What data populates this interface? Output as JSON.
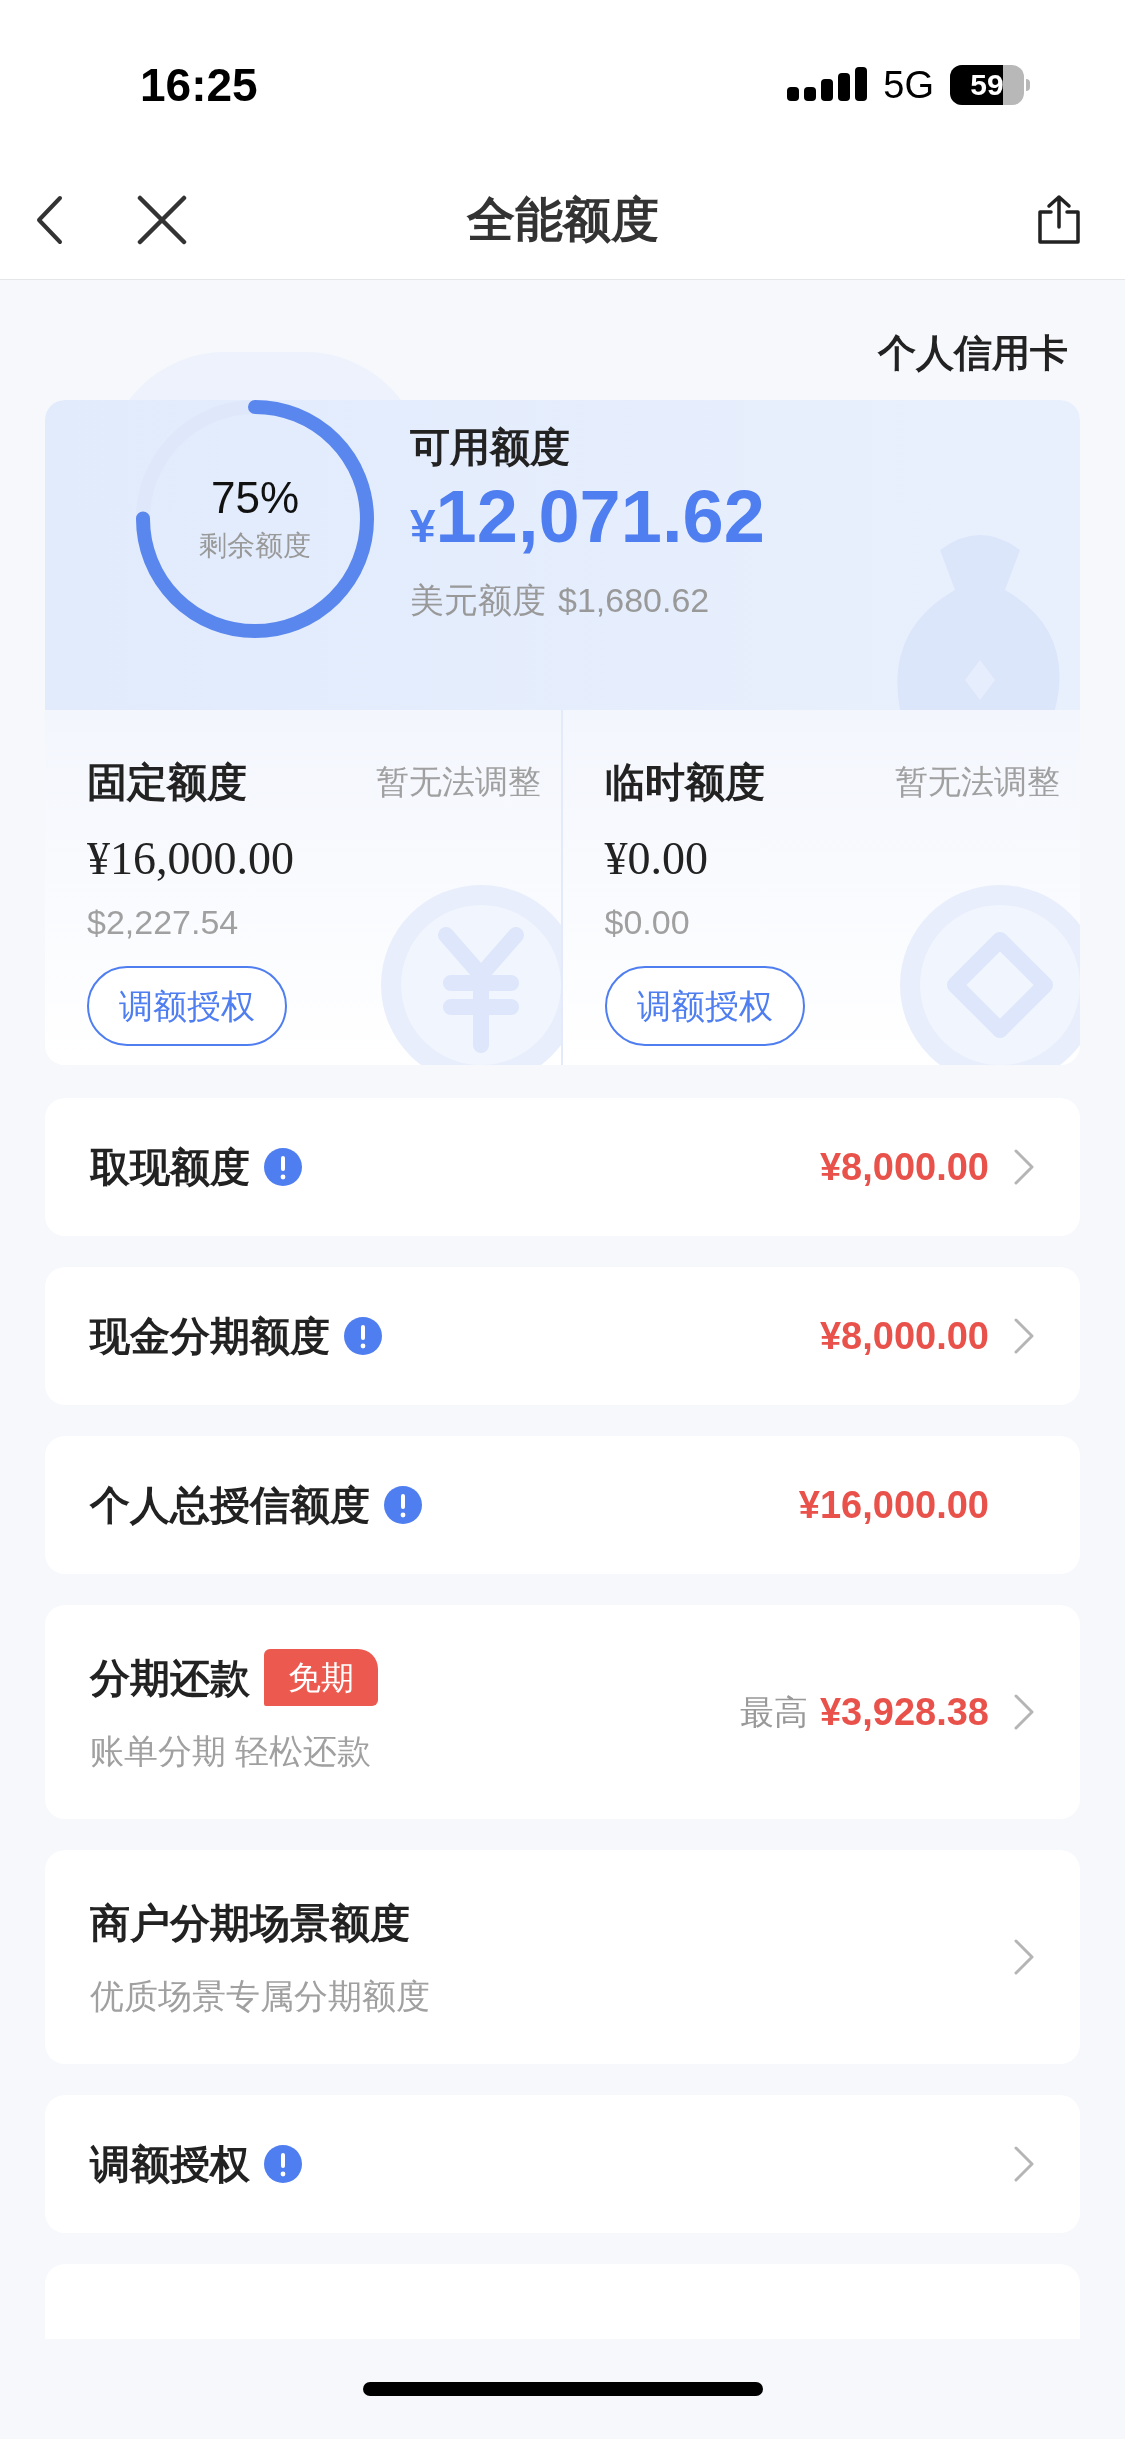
{
  "status_bar": {
    "time": "16:25",
    "network": "5G",
    "battery": "59"
  },
  "nav": {
    "title": "全能额度"
  },
  "card_type": "个人信用卡",
  "summary": {
    "ring": {
      "percent": "75%",
      "label": "剩余额度"
    },
    "available_label": "可用额度",
    "currency": "¥",
    "amount": "12,071.62",
    "usd_label": "美元额度",
    "usd_amount": "$1,680.62"
  },
  "limits": [
    {
      "title": "固定额度",
      "note": "暂无法调整",
      "amount": "¥16,000.00",
      "usd": "$2,227.54",
      "button": "调额授权",
      "kind": "yen"
    },
    {
      "title": "临时额度",
      "note": "暂无法调整",
      "amount": "¥0.00",
      "usd": "$0.00",
      "button": "调额授权",
      "kind": "diamond"
    }
  ],
  "rows": [
    {
      "title": "取现额度",
      "info": true,
      "amount": "¥8,000.00",
      "chevron": true
    },
    {
      "title": "现金分期额度",
      "info": true,
      "amount": "¥8,000.00",
      "chevron": true
    },
    {
      "title": "个人总授信额度",
      "info": true,
      "amount": "¥16,000.00",
      "chevron": false
    },
    {
      "title": "分期还款",
      "info": false,
      "badge": "免期",
      "subtitle": "账单分期 轻松还款",
      "prefix": "最高",
      "amount": "¥3,928.38",
      "chevron": true
    },
    {
      "title": "商户分期场景额度",
      "info": false,
      "subtitle": "优质场景专属分期额度",
      "chevron": true
    },
    {
      "title": "调额授权",
      "info": true,
      "chevron": true
    }
  ]
}
